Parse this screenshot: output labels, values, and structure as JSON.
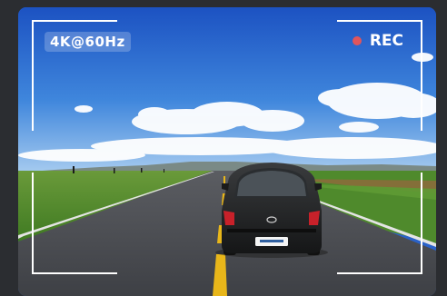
{
  "recorder": {
    "resolution_label": "4K@60Hz",
    "rec_label": "REC"
  },
  "scene": {
    "subject": "car-rear-view",
    "license_plate_text": ""
  },
  "colors": {
    "rec_dot": "#e0555c",
    "background": "#2b2d31",
    "sky_top": "#1f56c4",
    "road": "#4a4c52",
    "center_line": "#e8b61a"
  }
}
